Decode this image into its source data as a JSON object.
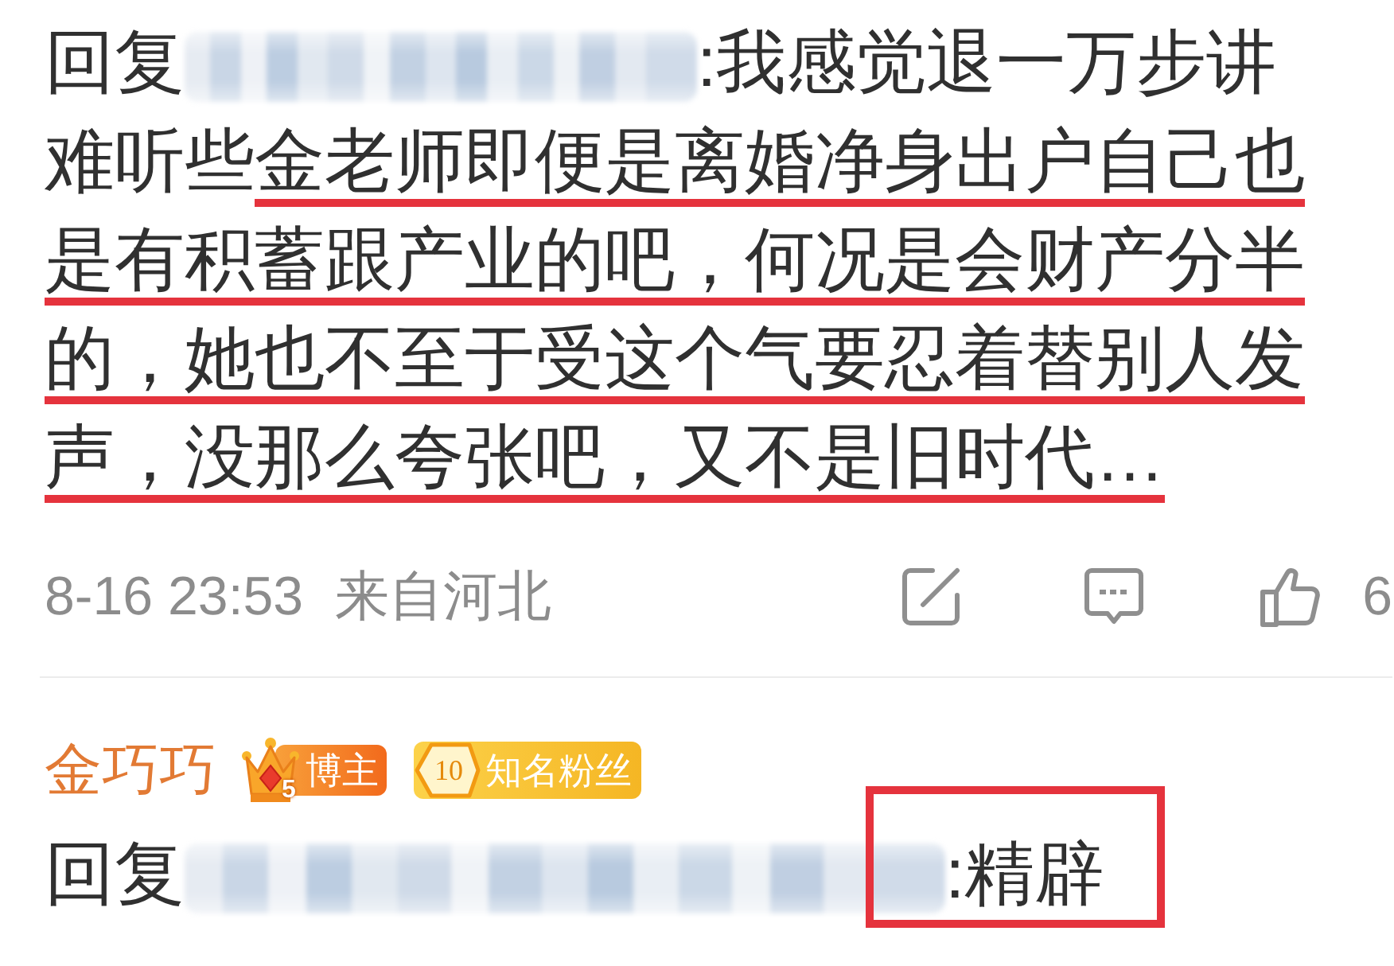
{
  "comments": [
    {
      "reply": {
        "prefix": "回复",
        "mention_redacted": true,
        "segments": [
          {
            "text": ":我感觉退一万步讲难听些",
            "underlined": false
          },
          {
            "text": "金老师即便是离婚净身出户自己也是有积蓄跟产业的吧，何况是会财产分半的，她也不至于受这个气要忍着替别人发声，没那么夸张吧，又不是旧时代…",
            "underlined": true
          }
        ]
      },
      "time": "8-16 23:53",
      "location": "来自河北",
      "actions": [
        {
          "kind": "repost"
        },
        {
          "kind": "comment"
        },
        {
          "kind": "like",
          "count": "6"
        }
      ]
    },
    {
      "author": {
        "name": "金巧巧",
        "badges": [
          {
            "kind": "blogger",
            "number": "5",
            "label": "博主"
          },
          {
            "kind": "fan",
            "number": "10",
            "label": "知名粉丝"
          }
        ]
      },
      "reply": {
        "prefix": "回复",
        "mention_redacted": true,
        "segments": [
          {
            "text": ":精辟",
            "boxed": true
          }
        ]
      }
    }
  ]
}
